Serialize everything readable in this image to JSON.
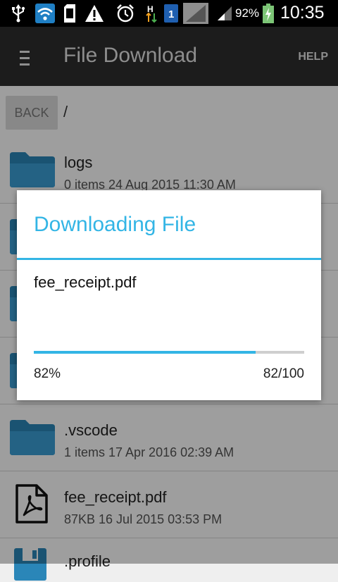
{
  "status_bar": {
    "battery_percent": "92%",
    "time": "10:35",
    "icons": [
      "usb-icon",
      "wifi-icon",
      "sd-card-icon",
      "warning-icon",
      "alarm-icon",
      "hspa-data-icon",
      "sim1-icon",
      "signal-icon",
      "signal-icon",
      "battery-charging-icon"
    ]
  },
  "action_bar": {
    "title": "File Download",
    "help_label": "HELP",
    "menu_icon": "hamburger-menu-icon"
  },
  "navigation": {
    "back_label": "BACK",
    "path": "/"
  },
  "files": [
    {
      "name": "logs",
      "meta": "0 items 24 Aug 2015 11:30 AM",
      "icon": "folder-icon"
    },
    {
      "name": "",
      "meta": "",
      "icon": "folder-icon"
    },
    {
      "name": "",
      "meta": "",
      "icon": "folder-icon"
    },
    {
      "name": "",
      "meta": "",
      "icon": "folder-icon"
    },
    {
      "name": ".vscode",
      "meta": "1 items 17 Apr 2016 02:39 AM",
      "icon": "folder-icon"
    },
    {
      "name": "fee_receipt.pdf",
      "meta": "87KB 16 Jul 2015 03:53 PM",
      "icon": "pdf-file-icon"
    },
    {
      "name": ".profile",
      "meta": "",
      "icon": "file-icon"
    }
  ],
  "dialog": {
    "title": "Downloading File",
    "filename": "fee_receipt.pdf",
    "progress_fraction": 0.82,
    "percent_label": "82%",
    "count_label": "82/100"
  },
  "colors": {
    "accent": "#33b5e5",
    "folder": "#3399cc",
    "action_bar": "#1c1c1c",
    "status_bar": "#000000"
  }
}
